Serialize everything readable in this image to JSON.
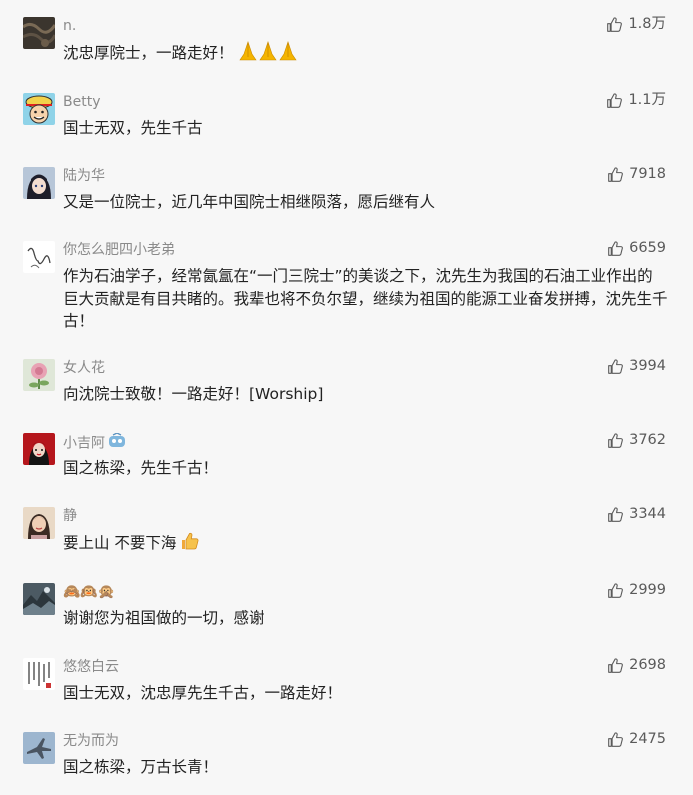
{
  "comments": [
    {
      "nickname": "n.",
      "text": "沈忠厚院士，一路走好！",
      "likes": "1.8万",
      "avatar_icon": "avatar-pattern-dark",
      "inline_emoji": "pray-hands-x3"
    },
    {
      "nickname": "Betty",
      "text": "国士无双，先生千古",
      "likes": "1.1万",
      "avatar_icon": "avatar-cartoon-pirate"
    },
    {
      "nickname": "陆为华",
      "text": "又是一位院士，近几年中国院士相继陨落，愿后继有人",
      "likes": "7918",
      "avatar_icon": "avatar-anime-girl"
    },
    {
      "nickname": "你怎么肥四小老弟",
      "text": "作为石油学子，经常氤氲在“一门三院士”的美谈之下，沈先生为我国的石油工业作出的巨大贡献是有目共睹的。我辈也将不负尔望，继续为祖国的能源工业奋发拼搏，沈先生千古！",
      "likes": "6659",
      "avatar_icon": "avatar-sketch-line"
    },
    {
      "nickname": "女人花",
      "text": "向沈院士致敬！一路走好！[Worship]",
      "likes": "3994",
      "avatar_icon": "avatar-flower"
    },
    {
      "nickname": "小吉阿",
      "text": "国之栋梁，先生千古！",
      "likes": "3762",
      "avatar_icon": "avatar-red-portrait",
      "nick_emoji": "vip-badge-icon"
    },
    {
      "nickname": "静",
      "text": "要上山 不要下海",
      "likes": "3344",
      "avatar_icon": "avatar-woman-photo",
      "inline_emoji": "thumbs-up-emoji"
    },
    {
      "nickname": "🙈🙉🙊",
      "text": "谢谢您为祖国做的一切，感谢",
      "likes": "2999",
      "avatar_icon": "avatar-landscape-dark"
    },
    {
      "nickname": "悠悠白云",
      "text": "国士无双，沈忠厚先生千古，一路走好！",
      "likes": "2698",
      "avatar_icon": "avatar-calligraphy"
    },
    {
      "nickname": "无为而为",
      "text": "国之栋梁，万古长青！",
      "likes": "2475",
      "avatar_icon": "avatar-jet-plane"
    }
  ],
  "colors": {
    "background": "#f7f7f7",
    "nickname": "#8a8a8a",
    "text": "#222222",
    "likes": "#5a5a5a"
  }
}
